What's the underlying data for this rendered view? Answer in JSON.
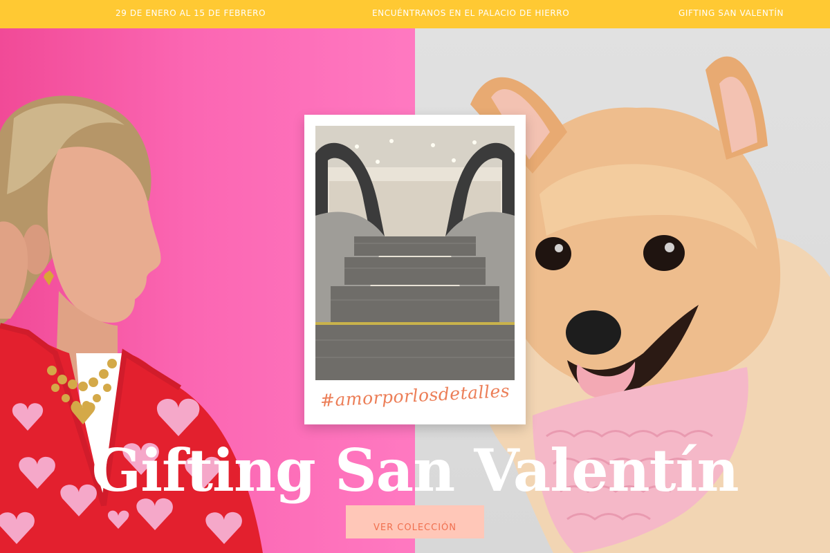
{
  "announcement_bar": {
    "items": [
      "29 DE ENERO AL 15 DE FEBRERO",
      "ENCUÉNTRANOS EN EL PALACIO DE HIERRO",
      "GIFTING SAN VALENTÍN"
    ]
  },
  "hero": {
    "polaroid_caption": "#amorporlosdetalles",
    "title": "Gifting San Valentín",
    "cta_label": "VER COLECCIÓN"
  },
  "colors": {
    "top_bar": "#ffc933",
    "left_panel": "#fb66b2",
    "right_panel": "#dedede",
    "caption": "#ec7e57",
    "cta_bg": "#ffc7b8",
    "cta_text": "#f06f4e"
  }
}
